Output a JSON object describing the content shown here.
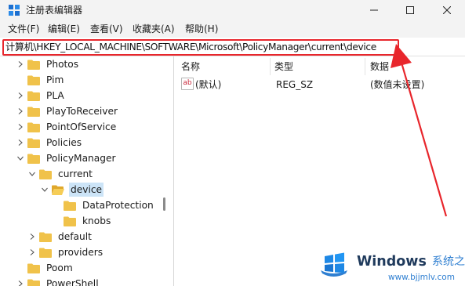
{
  "window": {
    "title": "注册表编辑器"
  },
  "menu": [
    "文件(F)",
    "编辑(E)",
    "查看(V)",
    "收藏夹(A)",
    "帮助(H)"
  ],
  "address": "计算机\\HKEY_LOCAL_MACHINE\\SOFTWARE\\Microsoft\\PolicyManager\\current\\device",
  "tree": [
    {
      "label": "Photos",
      "chevron": "right"
    },
    {
      "label": "Pim",
      "chevron": "none"
    },
    {
      "label": "PLA",
      "chevron": "right"
    },
    {
      "label": "PlayToReceiver",
      "chevron": "right"
    },
    {
      "label": "PointOfService",
      "chevron": "right"
    },
    {
      "label": "Policies",
      "chevron": "right"
    },
    {
      "label": "PolicyManager",
      "chevron": "down"
    },
    {
      "label": "current",
      "chevron": "down"
    },
    {
      "label": "device",
      "chevron": "down",
      "selected": true
    },
    {
      "label": "DataProtection",
      "chevron": "none"
    },
    {
      "label": "knobs",
      "chevron": "none"
    },
    {
      "label": "default",
      "chevron": "right"
    },
    {
      "label": "providers",
      "chevron": "right"
    },
    {
      "label": "Poom",
      "chevron": "none"
    },
    {
      "label": "PowerShell",
      "chevron": "right"
    }
  ],
  "list": {
    "headers": {
      "name": "名称",
      "type": "类型",
      "data": "数据"
    },
    "rows": [
      {
        "icon": "ab",
        "name": "(默认)",
        "type": "REG_SZ",
        "data": "(数值未设置)"
      }
    ]
  },
  "watermark": {
    "brand": "Windows",
    "cn": "系统之家",
    "url": "www.bjjmlv.com"
  },
  "colors": {
    "highlight": "#e8262c",
    "selection": "#cce4f7",
    "folder": "#f0c24a"
  }
}
